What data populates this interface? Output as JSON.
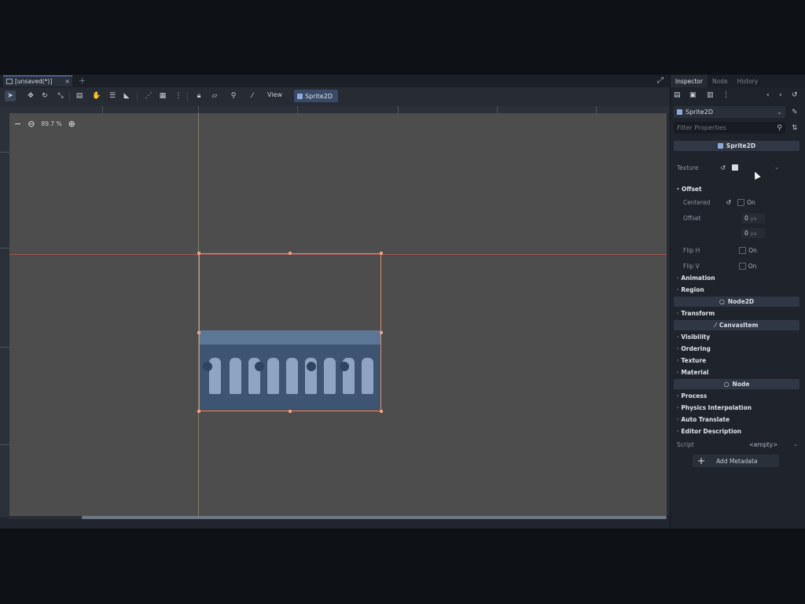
{
  "scene_tab": {
    "title": "[unsaved(*)]",
    "close": "×",
    "add": "+"
  },
  "toolbar": {
    "view_menu": "View",
    "sprite_menu": "Sprite2D",
    "icons": [
      "select-icon",
      "move-icon",
      "rotate-icon",
      "scale-icon",
      "ruler-icon",
      "pan-icon",
      "list-icon",
      "pivot-icon",
      "snap-icon",
      "grid-icon",
      "more-icon",
      "lock-icon",
      "group-icon",
      "bone-icon",
      "camera-icon"
    ]
  },
  "viewport": {
    "zoom_out": "−",
    "zoom_level": "89.7 %",
    "zoom_in": "+",
    "zoom_reset": "+"
  },
  "inspector": {
    "tabs": [
      "Inspector",
      "Node",
      "History"
    ],
    "selected_object": "Sprite2D",
    "filter_placeholder": "Filter Properties",
    "sections": {
      "sprite2d": "Sprite2D",
      "node2d": "Node2D",
      "canvasitem": "CanvasItem",
      "node": "Node"
    },
    "texture_label": "Texture",
    "offset_group": "Offset",
    "centered_label": "Centered",
    "centered_value": "On",
    "offset_label": "Offset",
    "offset_x": "0",
    "offset_y": "0",
    "px_unit": "px",
    "flip_h_label": "Flip H",
    "flip_h_value": "On",
    "flip_v_label": "Flip V",
    "flip_v_value": "On",
    "groups": {
      "animation": "Animation",
      "region": "Region",
      "transform": "Transform",
      "visibility": "Visibility",
      "ordering": "Ordering",
      "texture": "Texture",
      "material": "Material",
      "process": "Process",
      "physics_interpolation": "Physics Interpolation",
      "auto_translate": "Auto Translate",
      "editor_description": "Editor Description"
    },
    "script_label": "Script",
    "script_value": "<empty>",
    "add_metadata": "Add Metadata"
  }
}
